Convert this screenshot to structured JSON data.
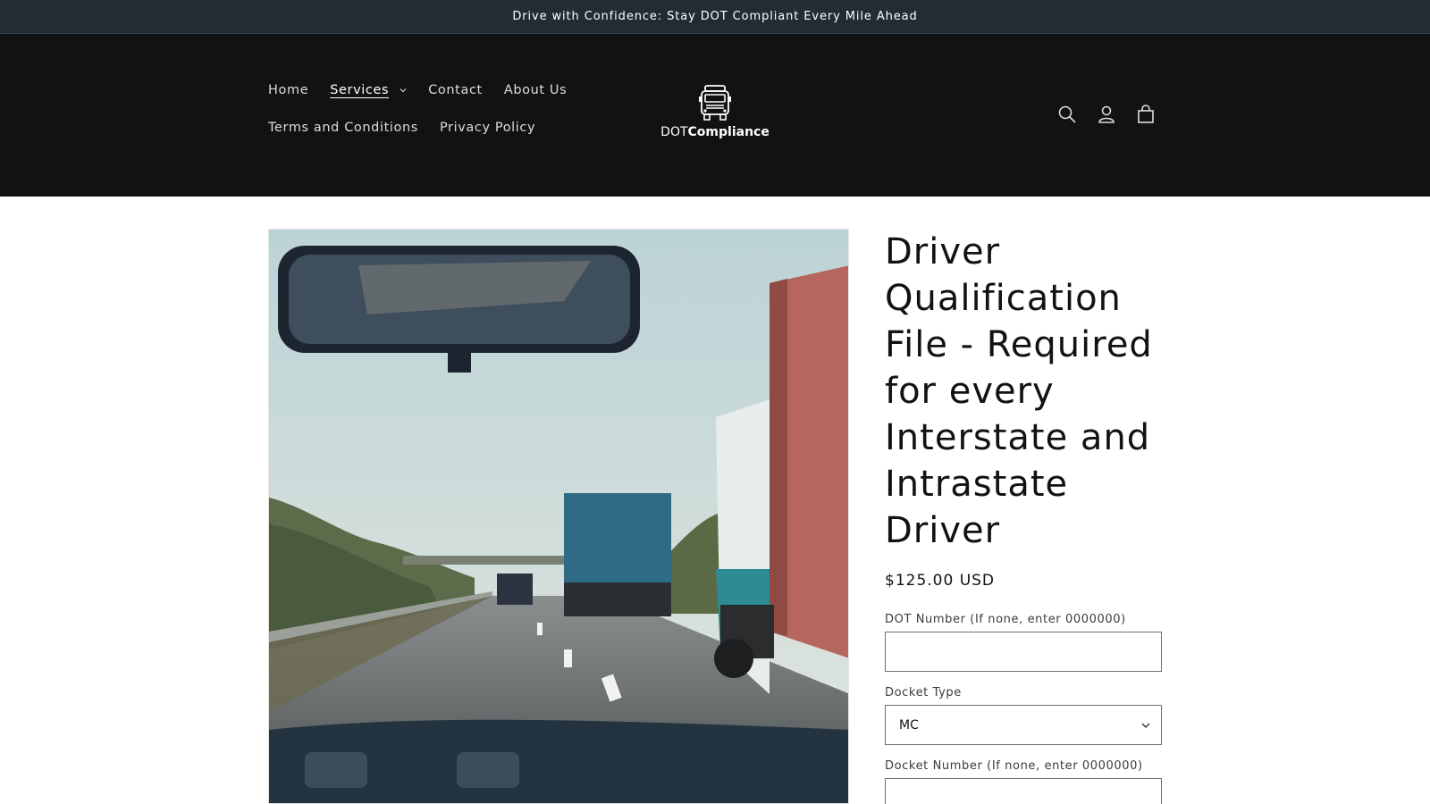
{
  "announcement": {
    "text": "Drive with Confidence: Stay DOT Compliant Every Mile Ahead"
  },
  "nav": {
    "row1": [
      {
        "label": "Home"
      },
      {
        "label": "Services"
      },
      {
        "label": "Contact"
      },
      {
        "label": "About Us"
      }
    ],
    "row2": [
      {
        "label": "Terms and Conditions"
      },
      {
        "label": "Privacy Policy"
      }
    ]
  },
  "logo": {
    "prefix": "DOT",
    "brand": "Compliance"
  },
  "header_icons": [
    "search-icon",
    "account-icon",
    "cart-icon"
  ],
  "product": {
    "title": "Driver Qualification File - Required for every Interstate and Intrastate Driver",
    "price": "$125.00 USD",
    "fields": {
      "dot_number_label": "DOT Number (If none, enter 0000000)",
      "dot_number_value": "",
      "docket_type_label": "Docket Type",
      "docket_type_value": "MC",
      "docket_number_label": "Docket Number (If none, enter 0000000)",
      "docket_number_value": ""
    }
  },
  "colors": {
    "announcement_bg": "#232b35",
    "header_bg": "#121212",
    "text": "#121212"
  }
}
